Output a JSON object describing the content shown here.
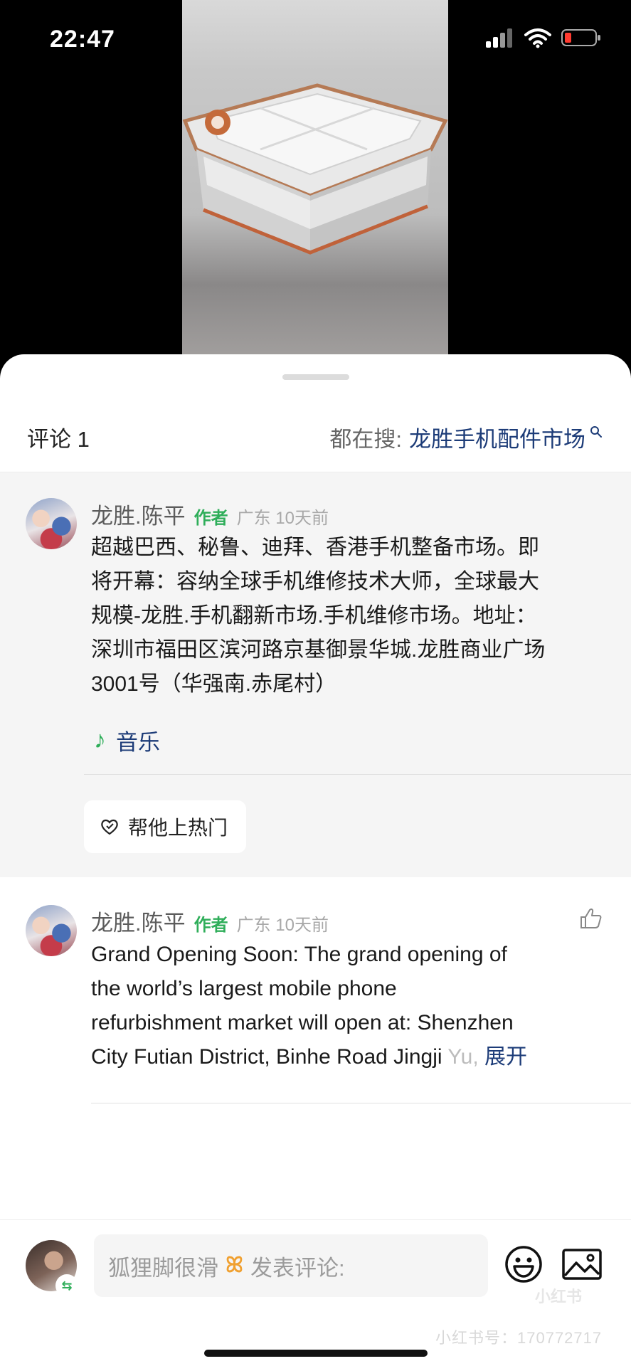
{
  "status_bar": {
    "time": "22:47"
  },
  "sheet": {
    "title": "评论 1",
    "search_prefix": "都在搜:",
    "search_term": "龙胜手机配件市场"
  },
  "comments": [
    {
      "author": "龙胜.陈平",
      "badge": "作者",
      "meta": "广东 10天前",
      "text_lines": [
        "超越巴西、秘鲁、迪拜、香港手机整备市场。即",
        "将开幕：容纳全球手机维修技术大师，全球最大",
        "规模-龙胜.手机翻新市场.手机维修市场。地址：",
        "深圳市福田区滨河路京基御景华城.龙胜商业广场",
        "3001号（华强南.赤尾村）"
      ],
      "music_label": "音乐",
      "boost_label": "帮他上热门"
    },
    {
      "author": "龙胜.陈平",
      "badge": "作者",
      "meta": "广东 10天前",
      "text_lines": [
        "Grand Opening Soon: The grand opening of",
        "the world’s largest mobile phone",
        "refurbishment market will open at: Shenzhen",
        "City Futian District, Binhe Road Jingji "
      ],
      "text_fade": "Yu,",
      "expand_label": "展开"
    }
  ],
  "bottom_bar": {
    "input_prefix": "狐狸脚很滑",
    "input_placeholder": "发表评论:",
    "watermark_id": "小红书号：170772717",
    "watermark_logo": "小红书"
  },
  "colors": {
    "accent_green": "#2fae5a",
    "link_blue": "#1d3c78"
  }
}
